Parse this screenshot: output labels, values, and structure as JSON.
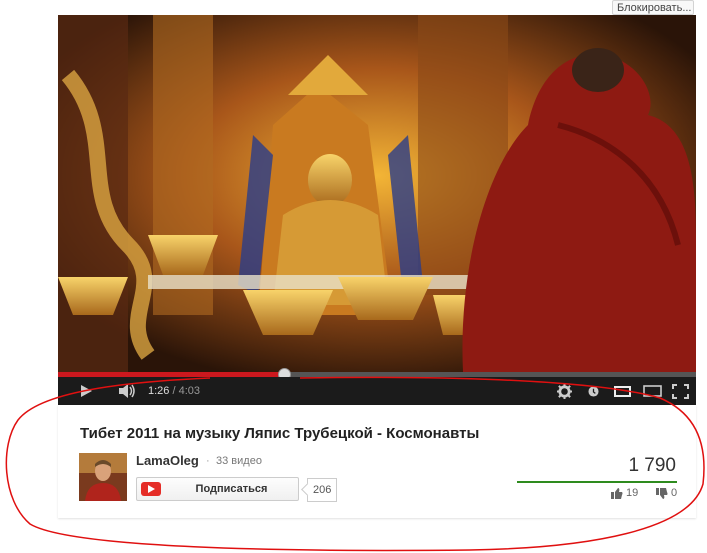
{
  "header": {
    "block_button_label": "Блокировать..."
  },
  "player": {
    "current_time": "1:26",
    "separator": "/",
    "duration": "4:03",
    "progress_fraction": 0.354,
    "accent_color": "#cc181e"
  },
  "video": {
    "title": "Тибет 2011 на музыку Ляпис Трубецкой - Космонавты",
    "channel_name": "LamaOleg",
    "channel_separator": "·",
    "video_count": "33 видео",
    "subscribe_label": "Подписаться",
    "subscriber_count": "206",
    "views": "1 790",
    "likes": "19",
    "dislikes": "0"
  },
  "icons": [
    "play-icon",
    "volume-icon",
    "settings-icon",
    "info-icon",
    "small-player-icon",
    "large-player-icon",
    "fullscreen-icon",
    "thumb-up-icon",
    "thumb-down-icon",
    "youtube-icon"
  ],
  "colors": {
    "annotation": "#e01010",
    "views_bar": "#2e8b1e",
    "subscribe_red": "#e52d27"
  }
}
